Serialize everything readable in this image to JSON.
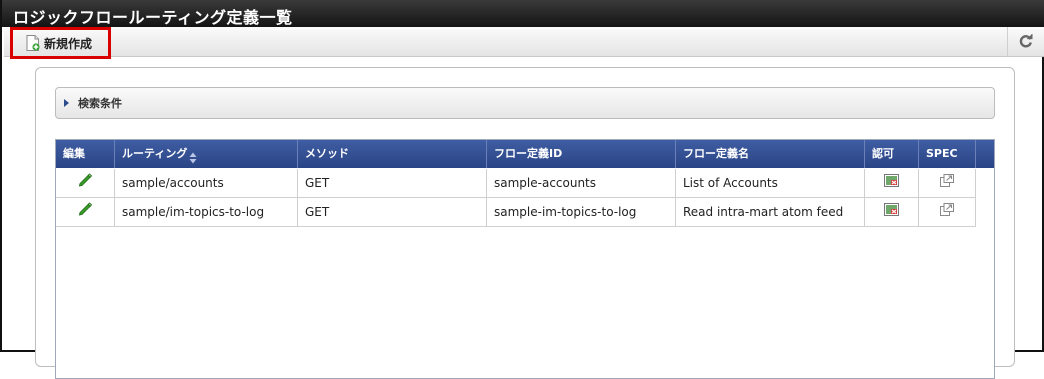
{
  "window": {
    "title": "ロジックフロールーティング定義一覧"
  },
  "toolbar": {
    "new_label": "新規作成",
    "new_icon": "document-add-icon",
    "refresh_icon": "refresh-icon"
  },
  "search": {
    "label": "検索条件",
    "collapsed": true
  },
  "table": {
    "headers": {
      "edit": "編集",
      "routing": "ルーティング",
      "method": "メソッド",
      "flow_id": "フロー定義ID",
      "flow_name": "フロー定義名",
      "auth": "認可",
      "spec": "SPEC"
    },
    "rows": [
      {
        "routing": "sample/accounts",
        "method": "GET",
        "flow_id": "sample-accounts",
        "flow_name": "List of Accounts"
      },
      {
        "routing": "sample/im-topics-to-log",
        "method": "GET",
        "flow_id": "sample-im-topics-to-log",
        "flow_name": "Read intra-mart atom feed"
      }
    ]
  },
  "colors": {
    "header_blue": "#2f4c8c",
    "highlight_red": "#d90000",
    "edit_green": "#3a9a2a"
  }
}
